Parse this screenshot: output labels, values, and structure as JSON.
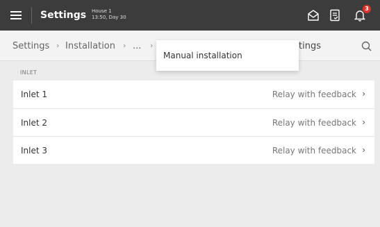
{
  "topbar": {
    "title": "Settings",
    "house_name": "House 1",
    "house_time": "13:50, Day 30",
    "notification_count": "3"
  },
  "breadcrumb": {
    "items": [
      "Settings",
      "Installation",
      "...",
      "tings"
    ],
    "separator": "›"
  },
  "dropdown": {
    "items": [
      "Manual installation"
    ]
  },
  "section": {
    "label": "INLET"
  },
  "rows": [
    {
      "name": "Inlet 1",
      "value": "Relay with feedback",
      "chevron": "›"
    },
    {
      "name": "Inlet 2",
      "value": "Relay with feedback",
      "chevron": "›"
    },
    {
      "name": "Inlet 3",
      "value": "Relay with feedback",
      "chevron": "›"
    }
  ],
  "colors": {
    "topbar": "#3c3c3c",
    "background": "#ececec",
    "badge": "#d9342b"
  },
  "icons": {
    "menu": "hamburger-icon",
    "topbar_left": "envelope-open-icon",
    "topbar_middle": "document-list-icon",
    "topbar_right": "bell-icon",
    "search": "search-icon"
  }
}
